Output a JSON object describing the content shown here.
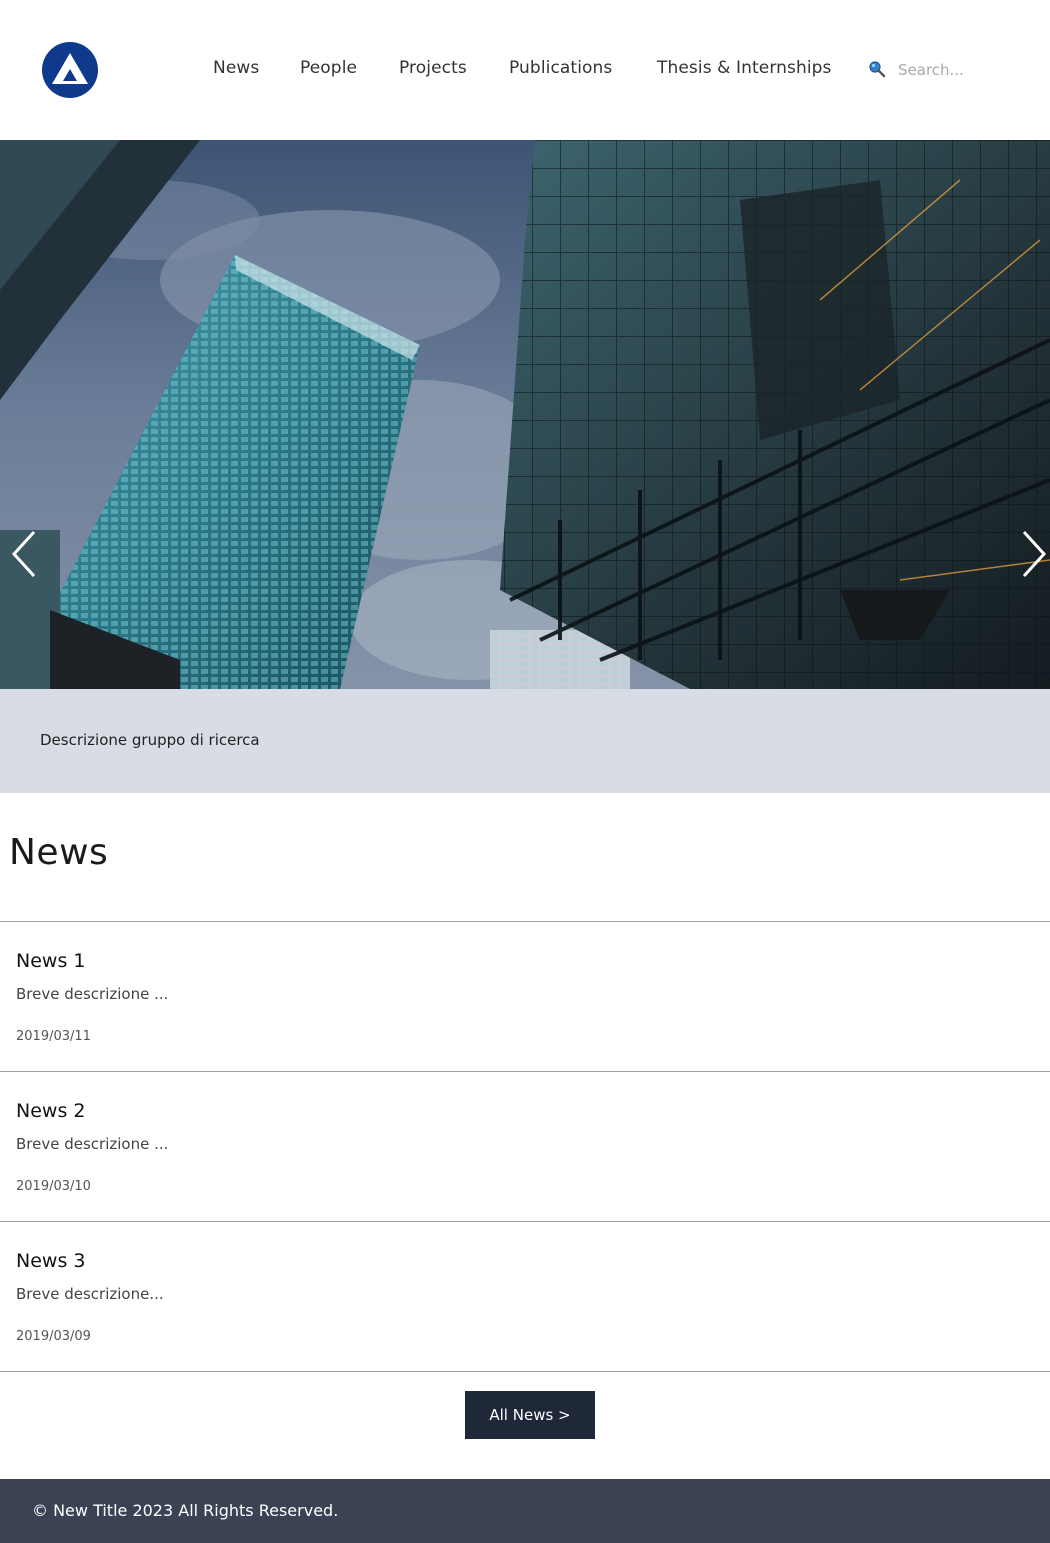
{
  "header": {
    "logo_icon": "triangle-logo-icon",
    "nav": [
      {
        "label": "News"
      },
      {
        "label": "People"
      },
      {
        "label": "Projects"
      },
      {
        "label": "Publications"
      },
      {
        "label": "Thesis & Internships"
      }
    ],
    "search": {
      "icon": "search-icon",
      "placeholder": "Search..."
    }
  },
  "hero": {
    "image": "skyscrapers-photo",
    "prev_icon": "chevron-left-icon",
    "next_icon": "chevron-right-icon"
  },
  "description": "Descrizione gruppo di ricerca",
  "news": {
    "title": "News",
    "items": [
      {
        "title": "News 1",
        "summary": "Breve descrizione ...",
        "date": "2019/03/11"
      },
      {
        "title": "News 2",
        "summary": "Breve descrizione ...",
        "date": "2019/03/10"
      },
      {
        "title": "News 3",
        "summary": "Breve descrizione...",
        "date": "2019/03/09"
      }
    ],
    "all_label": "All News >"
  },
  "footer": {
    "copyright": "© New Title 2023 All Rights Reserved."
  },
  "colors": {
    "brand": "#0f3a8c",
    "band": "#d8dce4",
    "button": "#1e2838",
    "footer": "#3a4254"
  }
}
